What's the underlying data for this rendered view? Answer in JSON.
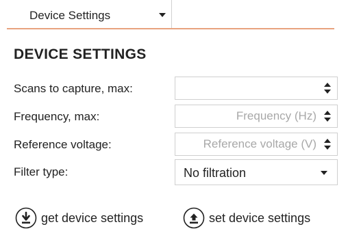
{
  "tab": {
    "label": "Device Settings",
    "icon": "chevron-down-icon"
  },
  "heading": "DEVICE SETTINGS",
  "fields": [
    {
      "label": "Scans to capture, max:",
      "value": "",
      "placeholder": ""
    },
    {
      "label": "Frequency, max:",
      "value": "",
      "placeholder": "Frequency (Hz)"
    },
    {
      "label": "Reference voltage:",
      "value": "",
      "placeholder": "Reference voltage (V)"
    }
  ],
  "filter": {
    "label": "Filter type:",
    "selected": "No filtration"
  },
  "actions": {
    "get": {
      "label": "get device settings",
      "icon": "download-circle-icon"
    },
    "set": {
      "label": "set device settings",
      "icon": "upload-circle-icon"
    }
  },
  "colors": {
    "accent_line": "#e8a27e",
    "border": "#cfcfcf",
    "text": "#222222",
    "placeholder": "#a8a8a8"
  }
}
